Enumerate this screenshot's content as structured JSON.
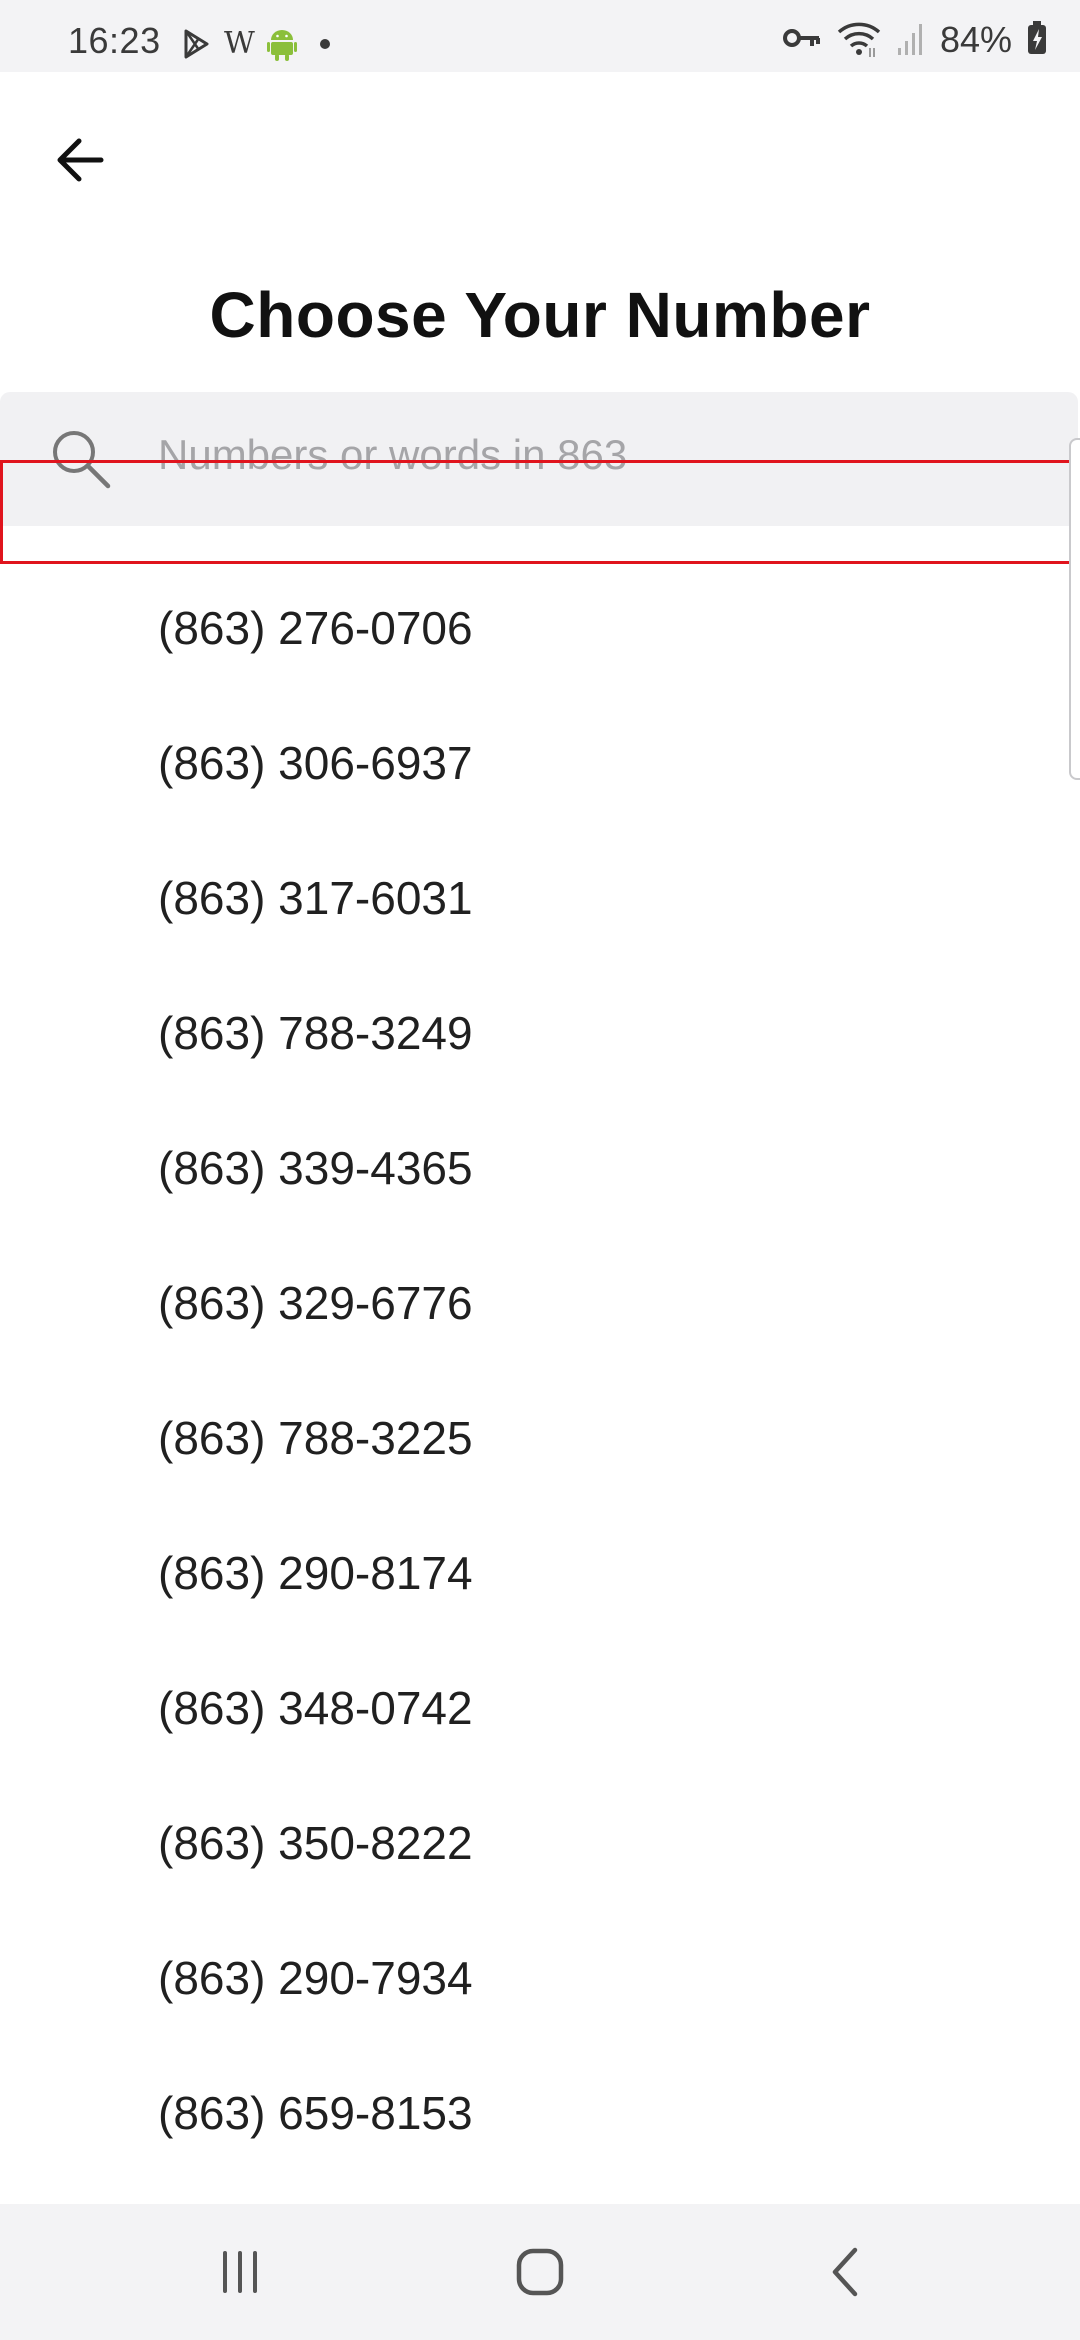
{
  "status_bar": {
    "time": "16:23",
    "left_icons": [
      "play-store-icon",
      "wikipedia-icon",
      "android-icon",
      "dot-icon"
    ],
    "wikipedia_glyph": "W",
    "right_icons": [
      "vpn-key-icon",
      "wifi-icon",
      "signal-icon",
      "battery-icon"
    ],
    "battery": "84%"
  },
  "header": {
    "back_icon": "back-arrow-icon",
    "title": "Choose Your Number"
  },
  "search": {
    "icon": "search-icon",
    "placeholder": "Numbers or words in 863",
    "value": ""
  },
  "numbers": [
    "(863) 276-0706",
    "(863) 306-6937",
    "(863) 317-6031",
    "(863) 788-3249",
    "(863) 339-4365",
    "(863) 329-6776",
    "(863) 788-3225",
    "(863) 290-8174",
    "(863) 348-0742",
    "(863) 350-8222",
    "(863) 290-7934",
    "(863) 659-8153"
  ],
  "nav_bar": {
    "buttons": [
      "recent-apps-icon",
      "home-icon",
      "nav-back-icon"
    ]
  },
  "colors": {
    "highlight": "#e0141d",
    "android_green": "#8bbf3b"
  }
}
